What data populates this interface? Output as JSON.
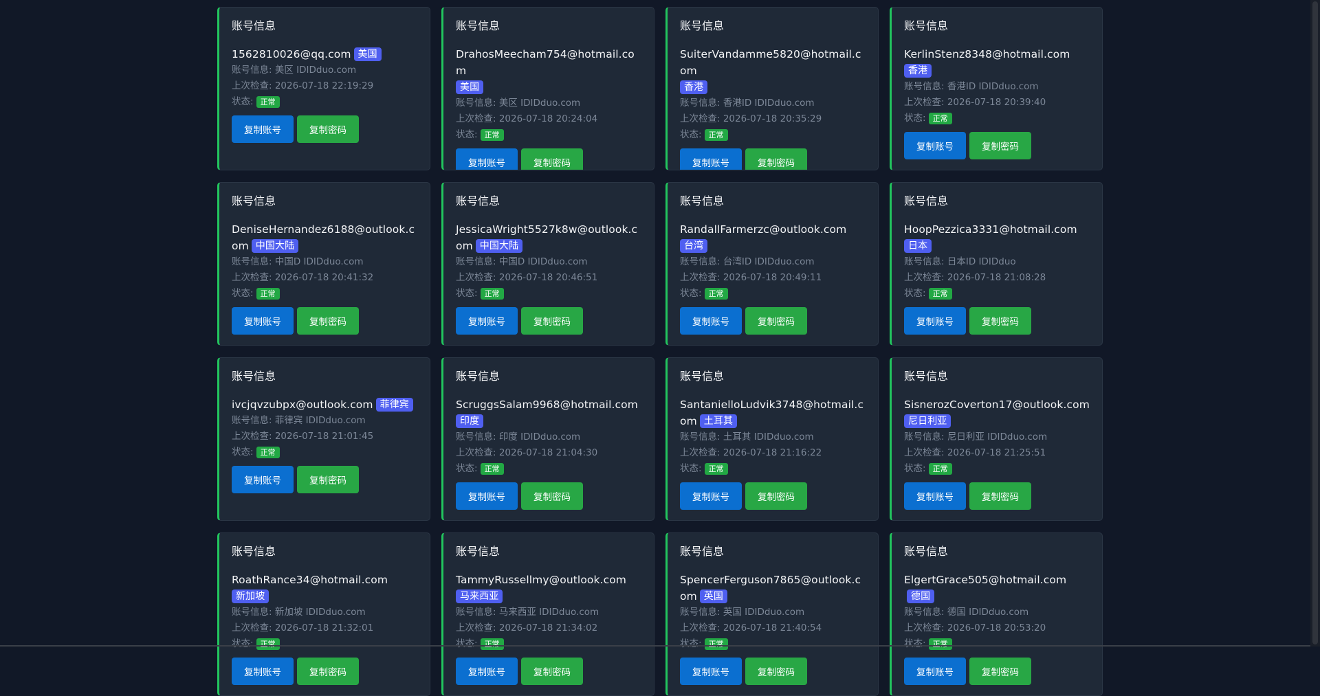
{
  "card_title": "账号信息",
  "labels": {
    "info_prefix": "账号信息: ",
    "check_prefix": "上次检查: ",
    "status_prefix": "状态:",
    "copy_account": "复制账号",
    "copy_password": "复制密码"
  },
  "colors": {
    "background": "#111827",
    "card": "#1f2937",
    "card_accent": "#22c55e",
    "region_badge": "#4f5ff0",
    "status_badge": "#22a844",
    "btn_account": "#0b6fd0",
    "btn_password": "#28a745"
  },
  "accounts": [
    {
      "email": "1562810026@qq.com",
      "region": "美国",
      "info": "美区 IDIDduo.com",
      "checked": "2026-07-18 22:19:29",
      "status": "正常",
      "layout": "inline"
    },
    {
      "email": "DrahosMeecham754@hotmail.com",
      "region": "美国",
      "info": "美区 IDIDduo.com",
      "checked": "2026-07-18 20:24:04",
      "status": "正常",
      "layout": "wrapped"
    },
    {
      "email": "SuiterVandamme5820@hotmail.com",
      "region": "香港",
      "info": "香港ID IDIDduo.com",
      "checked": "2026-07-18 20:35:29",
      "status": "正常",
      "layout": "wrapped"
    },
    {
      "email": "KerlinStenz8348@hotmail.com",
      "region": "香港",
      "info": "香港ID IDIDduo.com",
      "checked": "2026-07-18 20:39:40",
      "status": "正常",
      "layout": "wrapped"
    },
    {
      "email": "DeniseHernandez6188@outlook.com",
      "region": "中国大陆",
      "info": "中国D IDIDduo.com",
      "checked": "2026-07-18 20:41:32",
      "status": "正常",
      "layout": "inline"
    },
    {
      "email": "JessicaWright5527k8w@outlook.com",
      "region": "中国大陆",
      "info": "中国D IDIDduo.com",
      "checked": "2026-07-18 20:46:51",
      "status": "正常",
      "layout": "inline"
    },
    {
      "email": "RandallFarmerzc@outlook.com",
      "region": "台湾",
      "info": "台湾ID IDIDduo.com",
      "checked": "2026-07-18 20:49:11",
      "status": "正常",
      "layout": "wrapped"
    },
    {
      "email": "HoopPezzica3331@hotmail.com",
      "region": "日本",
      "info": "日本ID IDIDduo",
      "checked": "2026-07-18 21:08:28",
      "status": "正常",
      "layout": "wrapped"
    },
    {
      "email": "ivcjqvzubpx@outlook.com",
      "region": "菲律宾",
      "info": "菲律宾 IDIDduo.com",
      "checked": "2026-07-18 21:01:45",
      "status": "正常",
      "layout": "inline"
    },
    {
      "email": "ScruggsSalam9968@hotmail.com",
      "region": "印度",
      "info": "印度 IDIDduo.com",
      "checked": "2026-07-18 21:04:30",
      "status": "正常",
      "layout": "wrapped"
    },
    {
      "email": "SantanielloLudvik3748@hotmail.com",
      "region": "土耳其",
      "info": "土耳其 IDIDduo.com",
      "checked": "2026-07-18 21:16:22",
      "status": "正常",
      "layout": "inline"
    },
    {
      "email": "SisnerozCoverton17@outlook.com",
      "region": "尼日利亚",
      "info": "尼日利亚 IDIDduo.com",
      "checked": "2026-07-18 21:25:51",
      "status": "正常",
      "layout": "wrapped"
    },
    {
      "email": "RoathRance34@hotmail.com",
      "region": "新加坡",
      "info": "新加坡 IDIDduo.com",
      "checked": "2026-07-18 21:32:01",
      "status": "正常",
      "layout": "wrapped"
    },
    {
      "email": "TammyRussellmy@outlook.com",
      "region": "马来西亚",
      "info": "马来西亚 IDIDduo.com",
      "checked": "2026-07-18 21:34:02",
      "status": "正常",
      "layout": "wrapped"
    },
    {
      "email": "SpencerFerguson7865@outlook.com",
      "region": "英国",
      "info": "英国 IDIDduo.com",
      "checked": "2026-07-18 21:40:54",
      "status": "正常",
      "layout": "inline"
    },
    {
      "email": "ElgertGrace505@hotmail.com",
      "region": "德国",
      "info": "德国 IDIDduo.com",
      "checked": "2026-07-18 20:53:20",
      "status": "正常",
      "layout": "inline"
    }
  ]
}
